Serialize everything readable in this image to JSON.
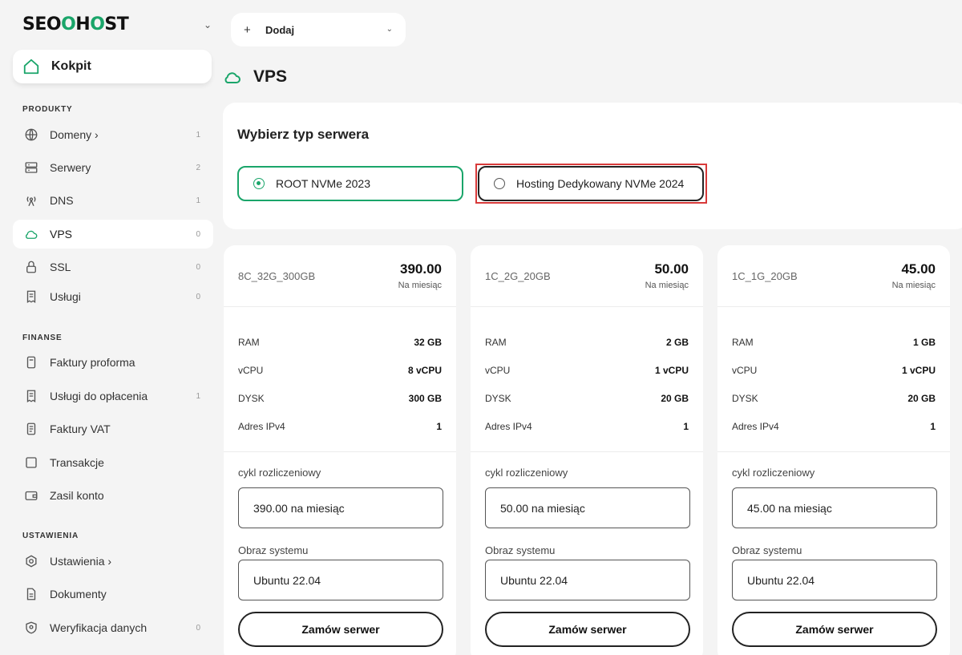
{
  "brand": {
    "logo_text_a": "SEO",
    "logo_text_b": "H",
    "logo_text_c": "ST"
  },
  "header": {
    "add_label": "Dodaj",
    "page_title": "VPS"
  },
  "sidebar": {
    "kokpit": "Kokpit",
    "sections": {
      "products": "PRODUKTY",
      "finance": "FINANSE",
      "settings": "USTAWIENIA"
    },
    "items": [
      {
        "label": "Domeny ›",
        "count": "1",
        "icon": "globe-icon"
      },
      {
        "label": "Serwery",
        "count": "2",
        "icon": "server-icon"
      },
      {
        "label": "DNS",
        "count": "1",
        "icon": "antenna-icon"
      },
      {
        "label": "VPS",
        "count": "0",
        "icon": "cloud-icon"
      },
      {
        "label": "SSL",
        "count": "0",
        "icon": "lock-icon"
      },
      {
        "label": "Usługi",
        "count": "0",
        "icon": "receipt-icon"
      },
      {
        "label": "Faktury proforma",
        "count": "",
        "icon": "document-icon"
      },
      {
        "label": "Usługi do opłacenia",
        "count": "1",
        "icon": "receipt-icon"
      },
      {
        "label": "Faktury VAT",
        "count": "",
        "icon": "document-icon"
      },
      {
        "label": "Transakcje",
        "count": "",
        "icon": "grid-icon"
      },
      {
        "label": "Zasil konto",
        "count": "",
        "icon": "wallet-icon"
      },
      {
        "label": "Ustawienia ›",
        "count": "",
        "icon": "gear-icon"
      },
      {
        "label": "Dokumenty",
        "count": "",
        "icon": "file-icon"
      },
      {
        "label": "Weryfikacja danych",
        "count": "0",
        "icon": "shield-icon"
      }
    ]
  },
  "server_type": {
    "heading": "Wybierz typ serwera",
    "options": [
      {
        "label": "ROOT NVMe 2023",
        "selected": true
      },
      {
        "label": "Hosting Dedykowany NVMe 2024",
        "selected": false
      }
    ]
  },
  "plan_labels": {
    "per_month": "Na miesiąc",
    "billing": "cykl rozliczeniowy",
    "os": "Obraz systemu",
    "order": "Zamów serwer",
    "ram": "RAM",
    "vcpu": "vCPU",
    "disk": "DYSK",
    "ipv4": "Adres IPv4"
  },
  "plans": [
    {
      "name": "8C_32G_300GB",
      "price": "390.00",
      "ram": "32 GB",
      "vcpu": "8 vCPU",
      "disk": "300 GB",
      "ipv4": "1",
      "billing": "390.00 na miesiąc",
      "os": "Ubuntu 22.04"
    },
    {
      "name": "1C_2G_20GB",
      "price": "50.00",
      "ram": "2 GB",
      "vcpu": "1 vCPU",
      "disk": "20 GB",
      "ipv4": "1",
      "billing": "50.00 na miesiąc",
      "os": "Ubuntu 22.04"
    },
    {
      "name": "1C_1G_20GB",
      "price": "45.00",
      "ram": "1 GB",
      "vcpu": "1 vCPU",
      "disk": "20 GB",
      "ipv4": "1",
      "billing": "45.00 na miesiąc",
      "os": "Ubuntu 22.04"
    }
  ],
  "colors": {
    "accent": "#1aa56a",
    "highlight": "#d83a3a"
  }
}
